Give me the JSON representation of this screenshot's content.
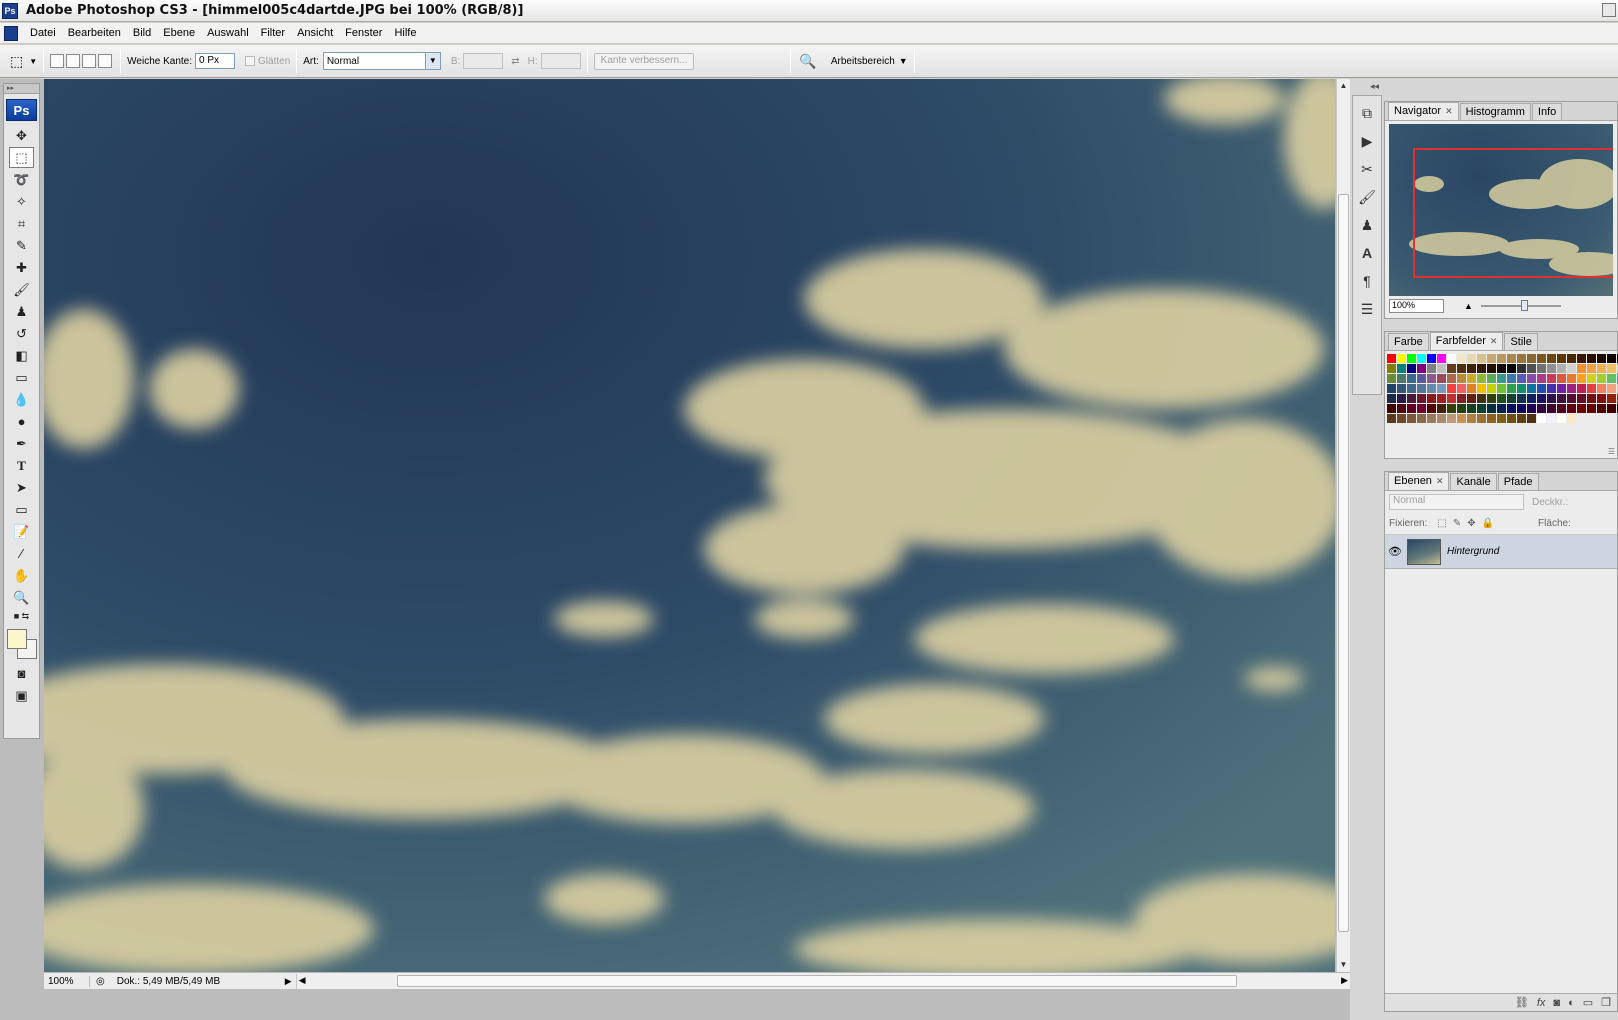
{
  "window": {
    "title": "Adobe Photoshop CS3 - [himmel005c4dartde.JPG bei 100% (RGB/8)]",
    "app_badge": "Ps"
  },
  "menu": [
    "Datei",
    "Bearbeiten",
    "Bild",
    "Ebene",
    "Auswahl",
    "Filter",
    "Ansicht",
    "Fenster",
    "Hilfe"
  ],
  "options": {
    "feather_label": "Weiche Kante:",
    "feather_value": "0 Px",
    "antialias_label": "Glätten",
    "style_label": "Art:",
    "style_value": "Normal",
    "width_label": "B:",
    "height_label": "H:",
    "refine_edge": "Kante verbessern...",
    "workspace": "Arbeitsbereich"
  },
  "toolbox": {
    "logo": "Ps"
  },
  "status": {
    "zoom": "100%",
    "doc_info": "Dok.: 5,49 MB/5,49 MB"
  },
  "navigator": {
    "tabs": [
      "Navigator",
      "Histogramm",
      "Info"
    ],
    "zoom": "100%"
  },
  "swatches_panel": {
    "tabs": [
      "Farbe",
      "Farbfelder",
      "Stile"
    ],
    "colors": [
      "#ff0000",
      "#ffff00",
      "#00ff00",
      "#00ffff",
      "#0000ff",
      "#ff00ff",
      "#ffffff",
      "#f0e6c8",
      "#e8d8b0",
      "#d8c090",
      "#c8a870",
      "#b89860",
      "#a88850",
      "#987840",
      "#886830",
      "#785820",
      "#684810",
      "#583800",
      "#482800",
      "#381800",
      "#281000",
      "#180800",
      "#100400",
      "#080200",
      "#808000",
      "#008080",
      "#000080",
      "#800080",
      "#808080",
      "#c0c0c0",
      "#604020",
      "#503010",
      "#402000",
      "#301800",
      "#201000",
      "#100800",
      "#000000",
      "#303030",
      "#505050",
      "#707070",
      "#909090",
      "#b0b0b0",
      "#d0d0d0",
      "#f09030",
      "#f0a040",
      "#f0b050",
      "#f0c060",
      "#f0d070",
      "#6a8a3a",
      "#4a7a6a",
      "#3a6a8a",
      "#5a5a9a",
      "#8a5a8a",
      "#9a4a5a",
      "#aa6a4a",
      "#ba8a3a",
      "#caaa2a",
      "#8aba3a",
      "#5aaa5a",
      "#3a9a8a",
      "#3a7aaa",
      "#5a5aba",
      "#8a4aaa",
      "#aa3a8a",
      "#ca3a5a",
      "#da5a3a",
      "#ea7a2a",
      "#faa01a",
      "#d0d020",
      "#a0d030",
      "#60c060",
      "#30b0a0",
      "#224466",
      "#335577",
      "#446688",
      "#557799",
      "#6688aa",
      "#7799bb",
      "#f04040",
      "#f06060",
      "#e08020",
      "#f0c000",
      "#c0d000",
      "#70c030",
      "#30a050",
      "#109070",
      "#1070a0",
      "#2050b0",
      "#4030b0",
      "#7020a0",
      "#a02080",
      "#c02050",
      "#e04040",
      "#f08060",
      "#f0a080",
      "#f0c0a0",
      "#1a2a4a",
      "#2a1a4a",
      "#4a1a3a",
      "#6a1a2a",
      "#8a1a1a",
      "#a02020",
      "#c03030",
      "#802020",
      "#602010",
      "#403010",
      "#304010",
      "#205020",
      "#104030",
      "#103050",
      "#102060",
      "#201060",
      "#301050",
      "#401040",
      "#501030",
      "#601020",
      "#701010",
      "#801010",
      "#902010",
      "#a03010",
      "#400000",
      "#500010",
      "#600020",
      "#700030",
      "#500000",
      "#402000",
      "#304000",
      "#204010",
      "#104020",
      "#004030",
      "#003040",
      "#002050",
      "#001060",
      "#100060",
      "#200050",
      "#300040",
      "#400030",
      "#500020",
      "#600010",
      "#700000",
      "#600000",
      "#500000",
      "#400000",
      "#300000",
      "#5a3a1a",
      "#6a4a2a",
      "#7a5a3a",
      "#8a6a4a",
      "#9a7a5a",
      "#aa8a6a",
      "#ba9a7a",
      "#ca9050",
      "#b08040",
      "#a07030",
      "#906020",
      "#806010",
      "#705010",
      "#604010",
      "#503010",
      "#ffffff",
      "#f0f0ff",
      "#fffff0",
      "#ffe8c0"
    ]
  },
  "layers_panel": {
    "tabs": [
      "Ebenen",
      "Kanäle",
      "Pfade"
    ],
    "blend_mode": "Normal",
    "opacity_label": "Deckkr.:",
    "lock_label": "Fixieren:",
    "fill_label": "Fläche:",
    "layers": [
      {
        "name": "Hintergrund",
        "visible": true
      }
    ]
  }
}
